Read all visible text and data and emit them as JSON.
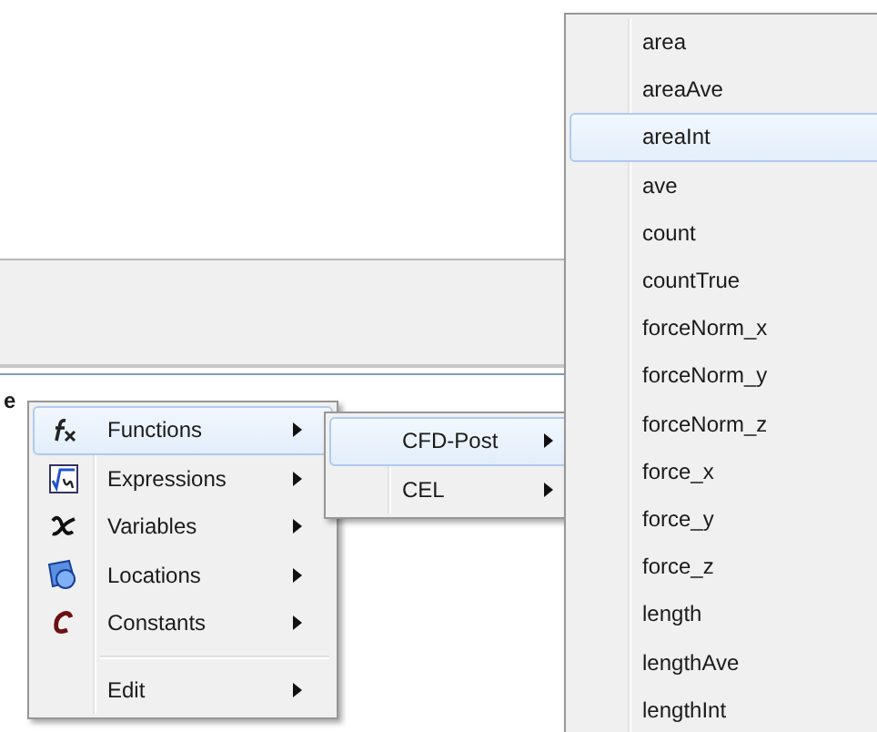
{
  "background": {
    "label_fragment": "e"
  },
  "menu": {
    "items": [
      {
        "kind": "item",
        "label": "Functions",
        "submenu": true,
        "selected": true
      },
      {
        "kind": "item",
        "label": "Expressions",
        "submenu": true,
        "selected": false
      },
      {
        "kind": "item",
        "label": "Variables",
        "submenu": true,
        "selected": false
      },
      {
        "kind": "item",
        "label": "Locations",
        "submenu": true,
        "selected": false
      },
      {
        "kind": "item",
        "label": "Constants",
        "submenu": true,
        "selected": false
      },
      {
        "kind": "separator"
      },
      {
        "kind": "item",
        "label": "Edit",
        "submenu": true,
        "selected": false
      }
    ]
  },
  "submenu": {
    "items": [
      {
        "label": "CFD-Post",
        "submenu": true,
        "selected": true
      },
      {
        "label": "CEL",
        "submenu": true,
        "selected": false
      }
    ]
  },
  "function_list": {
    "items": [
      {
        "label": "area",
        "selected": false
      },
      {
        "label": "areaAve",
        "selected": false
      },
      {
        "label": "areaInt",
        "selected": true
      },
      {
        "label": "ave",
        "selected": false
      },
      {
        "label": "count",
        "selected": false
      },
      {
        "label": "countTrue",
        "selected": false
      },
      {
        "label": "forceNorm_x",
        "selected": false
      },
      {
        "label": "forceNorm_y",
        "selected": false
      },
      {
        "label": "forceNorm_z",
        "selected": false
      },
      {
        "label": "force_x",
        "selected": false
      },
      {
        "label": "force_y",
        "selected": false
      },
      {
        "label": "force_z",
        "selected": false
      },
      {
        "label": "length",
        "selected": false
      },
      {
        "label": "lengthAve",
        "selected": false
      },
      {
        "label": "lengthInt",
        "selected": false
      }
    ]
  }
}
